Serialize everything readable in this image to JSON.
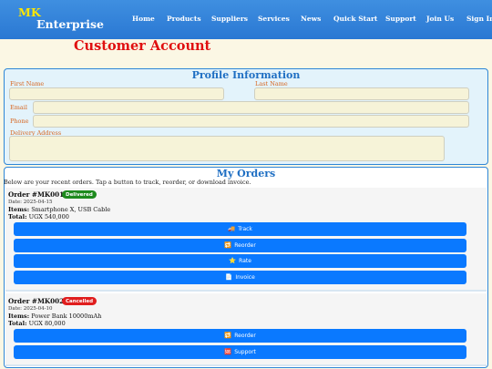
{
  "nav": {
    "brand_line1": "MK",
    "brand_line2": "Enterprise",
    "items": [
      "Home",
      "Products",
      "Suppliers",
      "Services",
      "News",
      "Quick Start",
      "Support",
      "Join Us",
      "Sign In"
    ]
  },
  "page_title": "Customer Account",
  "profile": {
    "title": "Profile Information",
    "first_name_label": "First Name",
    "last_name_label": "Last Name",
    "email_label": "Email",
    "phone_label": "Phone",
    "address_label": "Delivery Address",
    "first_name_value": "",
    "last_name_value": "",
    "email_value": "",
    "phone_value": "",
    "address_value": ""
  },
  "orders": {
    "title": "My Orders",
    "intro": "Below are your recent orders. Tap a button to track, reorder, or download invoice.",
    "items_label": "Items:",
    "total_label": "Total:",
    "list": [
      {
        "order_no": "Order #MK001",
        "status": "Delivered",
        "date": "Date: 2025-04-15",
        "items": "Smartphone X, USB Cable",
        "total": "UGX 540,000",
        "buttons": [
          {
            "icon": "🚚",
            "label": "Track"
          },
          {
            "icon": "🔁",
            "label": "Reorder"
          },
          {
            "icon": "⭐",
            "label": "Rate"
          },
          {
            "icon": "📄",
            "label": "Invoice"
          }
        ]
      },
      {
        "order_no": "Order #MK002",
        "status": "Cancelled",
        "date": "Date: 2025-04-10",
        "items": "Power Bank 10000mAh",
        "total": "UGX 80,000",
        "buttons": [
          {
            "icon": "🔁",
            "label": "Reorder"
          },
          {
            "icon": "🆘",
            "label": "Support"
          }
        ]
      }
    ]
  },
  "colors": {
    "nav_bg": "#2a78d3",
    "brand_accent": "#ffe600",
    "title_red": "#e01010",
    "section_border": "#2e86d6",
    "label_orange": "#d7661f",
    "button_blue": "#0a79ff",
    "delivered_green": "#1d8a1d",
    "cancelled_red": "#e01e1e"
  },
  "icons": {
    "track": "truck-icon",
    "reorder": "repeat-icon",
    "rate": "star-icon",
    "invoice": "document-icon",
    "support": "sos-icon"
  }
}
